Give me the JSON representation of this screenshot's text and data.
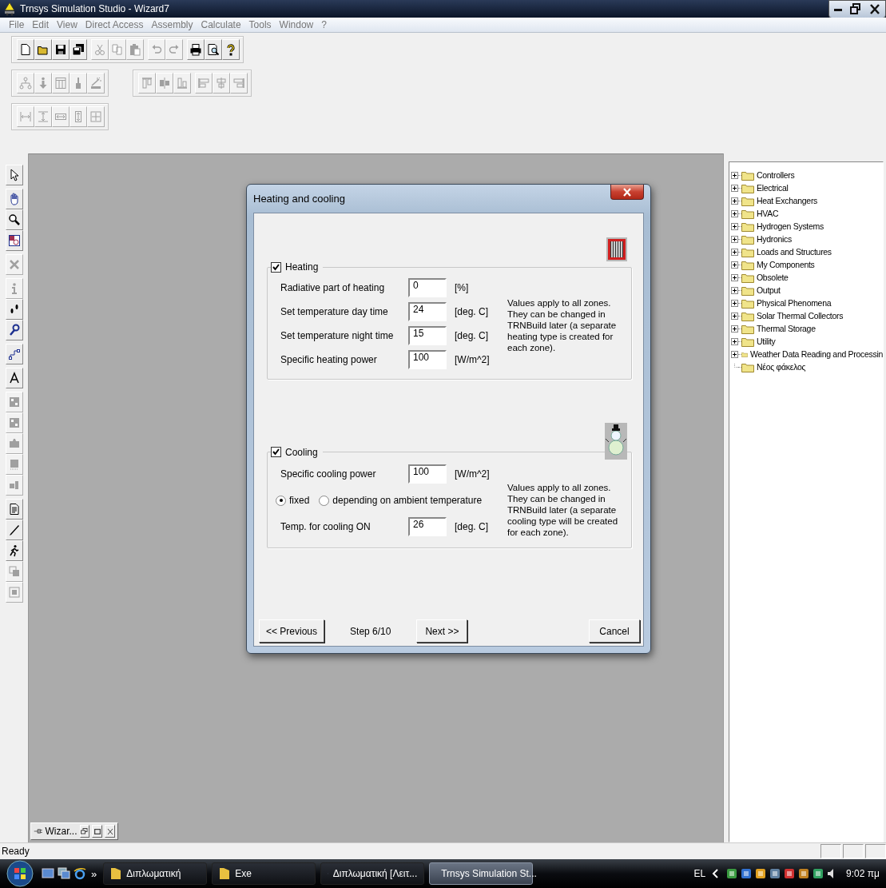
{
  "window": {
    "title": "Trnsys Simulation Studio - Wizard7"
  },
  "menu": [
    "File",
    "Edit",
    "View",
    "Direct Access",
    "Assembly",
    "Calculate",
    "Tools",
    "Window",
    "?"
  ],
  "toolbar_rows": [
    [
      {
        "buttons": [
          {
            "kind": "button",
            "disabled": false
          },
          {
            "kind": "button",
            "disabled": false
          },
          {
            "kind": "button",
            "disabled": false
          },
          {
            "kind": "button",
            "disabled": false
          },
          {
            "kind": "separator"
          },
          {
            "kind": "button",
            "disabled": true
          },
          {
            "kind": "button",
            "disabled": true
          },
          {
            "kind": "button",
            "disabled": true
          },
          {
            "kind": "separator"
          },
          {
            "kind": "button",
            "disabled": true
          },
          {
            "kind": "button",
            "disabled": true
          },
          {
            "kind": "separator"
          },
          {
            "kind": "button",
            "disabled": false
          },
          {
            "kind": "button",
            "disabled": false
          },
          {
            "kind": "button",
            "disabled": false
          }
        ]
      }
    ],
    [
      {
        "buttons": [
          {
            "kind": "button",
            "disabled": true
          },
          {
            "kind": "button",
            "disabled": true
          },
          {
            "kind": "button",
            "disabled": true
          },
          {
            "kind": "button",
            "disabled": true
          },
          {
            "kind": "button",
            "disabled": true
          }
        ]
      },
      {
        "buttons": [
          {
            "kind": "button",
            "disabled": true
          },
          {
            "kind": "button",
            "disabled": true
          },
          {
            "kind": "button",
            "disabled": true
          },
          {
            "kind": "separator"
          },
          {
            "kind": "button",
            "disabled": true
          },
          {
            "kind": "button",
            "disabled": true
          },
          {
            "kind": "button",
            "disabled": true
          }
        ]
      }
    ],
    [
      {
        "buttons": [
          {
            "kind": "button",
            "disabled": true
          },
          {
            "kind": "button",
            "disabled": true
          },
          {
            "kind": "button",
            "disabled": true
          },
          {
            "kind": "button",
            "disabled": true
          },
          {
            "kind": "button",
            "disabled": true
          }
        ]
      }
    ]
  ],
  "left_toolbar": [
    {
      "kind": "button",
      "disabled": false
    },
    {
      "kind": "separator"
    },
    {
      "kind": "button",
      "disabled": false
    },
    {
      "kind": "button",
      "disabled": false
    },
    {
      "kind": "button",
      "disabled": false
    },
    {
      "kind": "separator"
    },
    {
      "kind": "button",
      "disabled": true
    },
    {
      "kind": "separator"
    },
    {
      "kind": "button",
      "disabled": true
    },
    {
      "kind": "button",
      "disabled": false
    },
    {
      "kind": "button",
      "disabled": false
    },
    {
      "kind": "separator"
    },
    {
      "kind": "button",
      "disabled": false
    },
    {
      "kind": "separator"
    },
    {
      "kind": "button",
      "disabled": false
    },
    {
      "kind": "separator"
    },
    {
      "kind": "button",
      "disabled": true
    },
    {
      "kind": "button",
      "disabled": true
    },
    {
      "kind": "button",
      "disabled": true
    },
    {
      "kind": "button",
      "disabled": true
    },
    {
      "kind": "button",
      "disabled": true
    },
    {
      "kind": "separator"
    },
    {
      "kind": "button",
      "disabled": false
    },
    {
      "kind": "button",
      "disabled": false
    },
    {
      "kind": "button",
      "disabled": false
    },
    {
      "kind": "button",
      "disabled": true
    },
    {
      "kind": "button",
      "disabled": true
    }
  ],
  "dialog": {
    "title": "Heating and cooling",
    "sections": [
      {
        "kind": "heating",
        "label": "Heating",
        "checked": true,
        "note": "Values apply to all zones. They can be changed in TRNBuild later (a separate heating type is created for each zone).",
        "rows": [
          {
            "kind": "field",
            "label": "Radiative part of heating",
            "value": "0",
            "unit": "[%]"
          },
          {
            "kind": "field",
            "label": "Set temperature day time",
            "value": "24",
            "unit": "[deg. C]"
          },
          {
            "kind": "field",
            "label": "Set temperature night time",
            "value": "15",
            "unit": "[deg. C]"
          },
          {
            "kind": "field",
            "label": "Specific heating power",
            "value": "100",
            "unit": "[W/m^2]"
          }
        ]
      },
      {
        "kind": "cooling",
        "label": "Cooling",
        "checked": true,
        "note": "Values apply to all zones. They can be changed in TRNBuild later (a separate cooling type will be created for each zone).",
        "rows": [
          {
            "kind": "field",
            "label": "Specific cooling power",
            "value": "100",
            "unit": "[W/m^2]"
          },
          {
            "kind": "radios",
            "options": [
              {
                "label": "fixed",
                "selected": true
              },
              {
                "label": "depending on ambient temperature",
                "selected": false
              }
            ]
          },
          {
            "kind": "field",
            "label": "Temp. for cooling ON",
            "value": "26",
            "unit": "[deg. C]"
          }
        ]
      }
    ],
    "footer": [
      {
        "kind": "button",
        "label": "<< Previous"
      },
      {
        "kind": "text",
        "label": "Step 6/10"
      },
      {
        "kind": "button",
        "label": "Next >>"
      },
      {
        "kind": "spacer"
      },
      {
        "kind": "button",
        "label": "Cancel"
      }
    ]
  },
  "component_tree": [
    {
      "label": "Controllers",
      "expandable": true
    },
    {
      "label": "Electrical",
      "expandable": true
    },
    {
      "label": "Heat Exchangers",
      "expandable": true
    },
    {
      "label": "HVAC",
      "expandable": true
    },
    {
      "label": "Hydrogen Systems",
      "expandable": true
    },
    {
      "label": "Hydronics",
      "expandable": true
    },
    {
      "label": "Loads and Structures",
      "expandable": true
    },
    {
      "label": "My Components",
      "expandable": true
    },
    {
      "label": "Obsolete",
      "expandable": true
    },
    {
      "label": "Output",
      "expandable": true
    },
    {
      "label": "Physical Phenomena",
      "expandable": true
    },
    {
      "label": "Solar Thermal Collectors",
      "expandable": true
    },
    {
      "label": "Thermal Storage",
      "expandable": true
    },
    {
      "label": "Utility",
      "expandable": true
    },
    {
      "label": "Weather Data Reading and Processin",
      "expandable": true
    },
    {
      "label": "Νέος φάκελος",
      "expandable": false
    }
  ],
  "minimized_window": {
    "title": "Wizar..."
  },
  "status_bar": {
    "text": "Ready"
  },
  "taskbar": {
    "overflow": "»",
    "tasks": [
      {
        "label": "Διπλωματική",
        "selected": false
      },
      {
        "label": "Exe",
        "selected": false
      },
      {
        "label": "Διπλωματική [Λειτ...",
        "selected": false
      },
      {
        "label": "Trnsys Simulation St...",
        "selected": true
      }
    ],
    "language": "EL",
    "clock": "9:02 πμ"
  }
}
